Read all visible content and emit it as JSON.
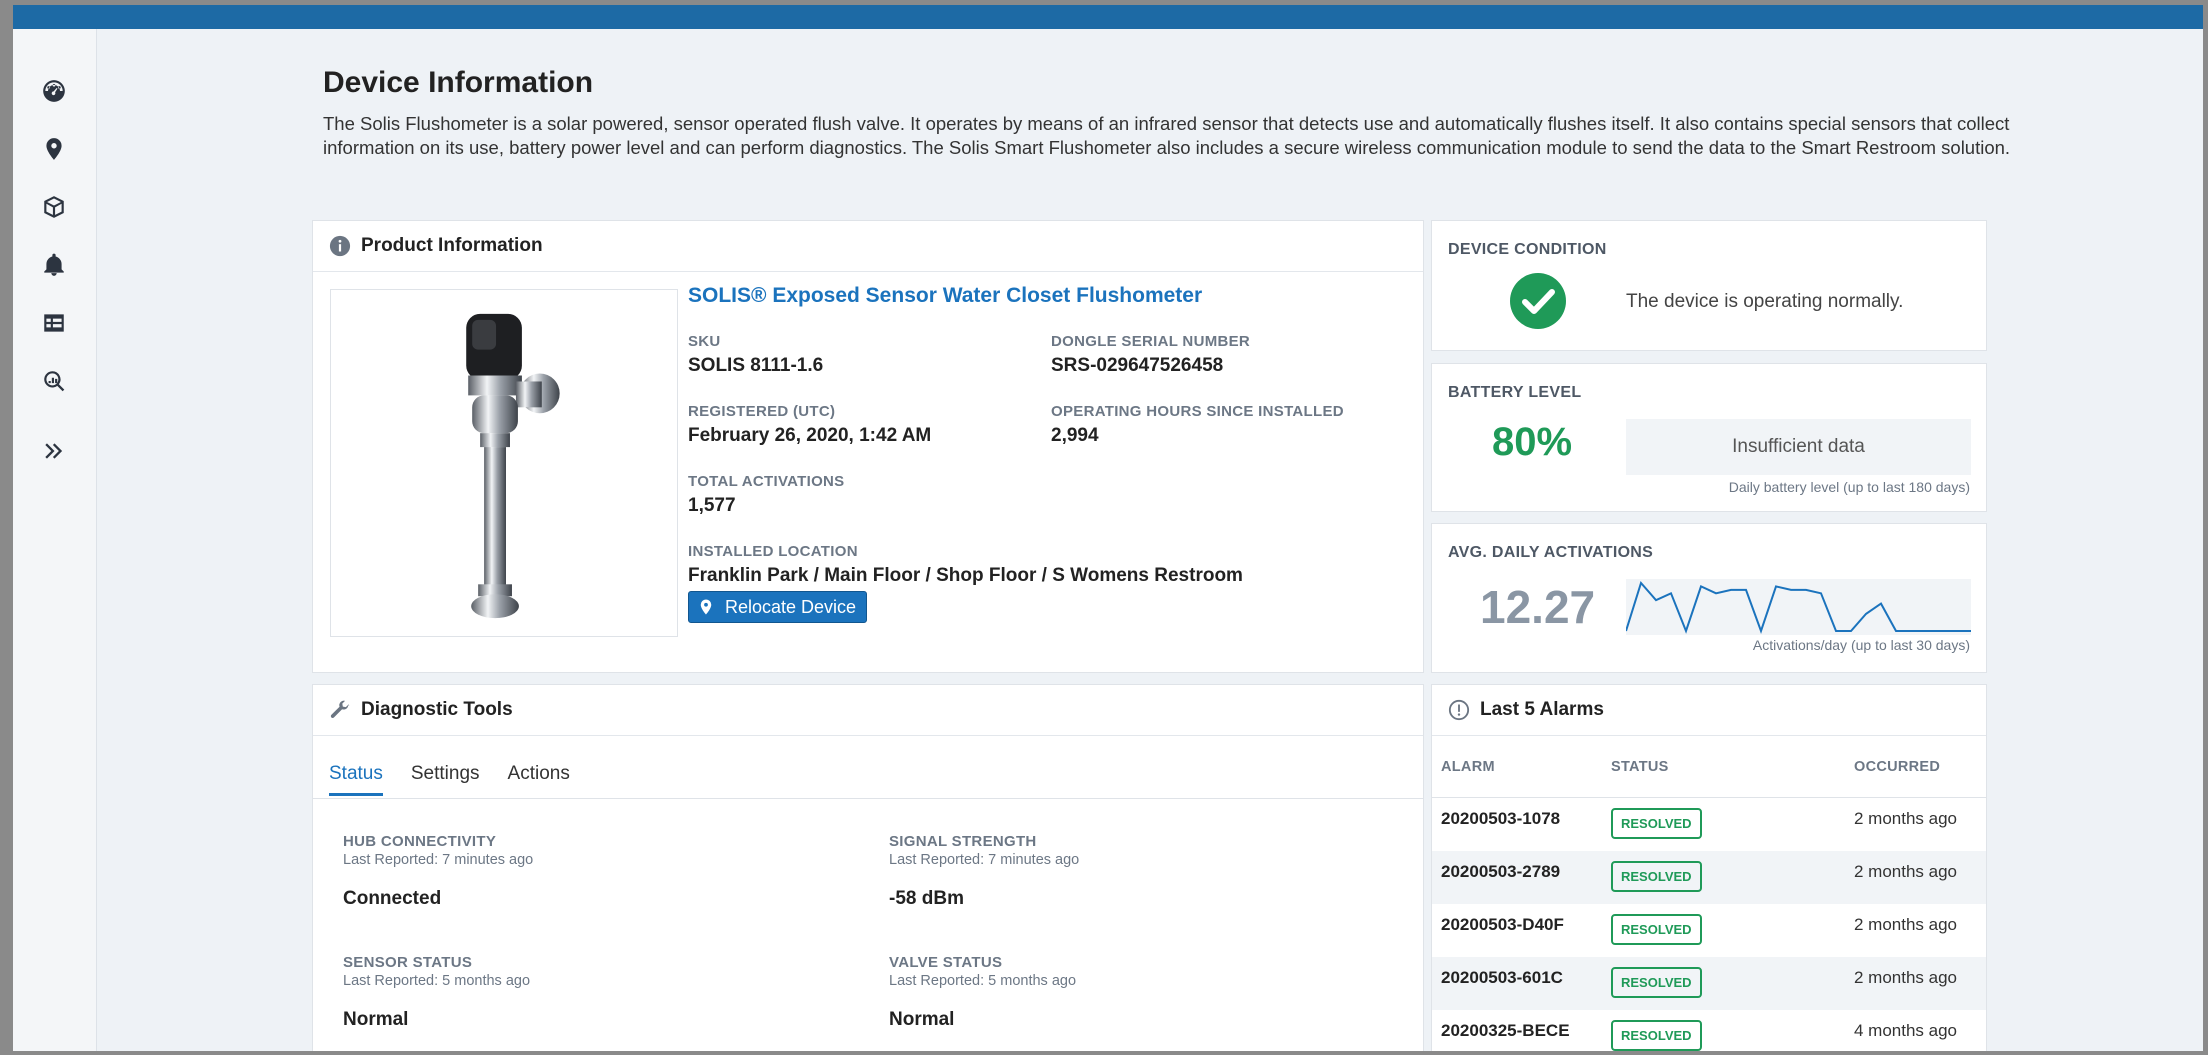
{
  "page": {
    "title": "Device Information",
    "intro": "The Solis Flushometer is a solar powered, sensor operated flush valve. It operates by means of an infrared sensor that detects use and automatically flushes itself. It also contains special sensors that collect information on its use, battery power level and can perform diagnostics. The Solis Smart Flushometer also includes a secure wireless communication module to send the data to the Smart Restroom solution."
  },
  "sidebar": {
    "items": [
      {
        "icon": "dashboard-icon"
      },
      {
        "icon": "location-pin-icon"
      },
      {
        "icon": "cube-icon"
      },
      {
        "icon": "bell-icon"
      },
      {
        "icon": "table-icon"
      },
      {
        "icon": "search-analytics-icon"
      },
      {
        "icon": "chevron-double-right-icon"
      }
    ]
  },
  "product": {
    "header": "Product Information",
    "name": "SOLIS® Exposed Sensor Water Closet Flushometer",
    "sku_label": "SKU",
    "sku": "SOLIS 8111-1.6",
    "dongle_label": "DONGLE SERIAL NUMBER",
    "dongle": "SRS-029647526458",
    "registered_label": "REGISTERED (UTC)",
    "registered": "February 26, 2020, 1:42 AM",
    "hours_label": "OPERATING HOURS SINCE INSTALLED",
    "hours": "2,994",
    "activations_label": "TOTAL ACTIVATIONS",
    "activations": "1,577",
    "location_label": "INSTALLED LOCATION",
    "location": "Franklin Park / Main Floor / Shop Floor / S Womens Restroom",
    "relocate_label": "Relocate Device"
  },
  "condition": {
    "title": "DEVICE CONDITION",
    "message": "The device is operating normally.",
    "status_color": "#1f9a58"
  },
  "battery": {
    "title": "BATTERY LEVEL",
    "value": "80%",
    "chart_text": "Insufficient data",
    "caption": "Daily battery level (up to last 180 days)",
    "accent": "#1f9a58"
  },
  "activations": {
    "title": "AVG. DAILY ACTIVATIONS",
    "value": "12.27",
    "caption": "Activations/day (up to last 30 days)",
    "sparkline": [
      0,
      14,
      9,
      11,
      0,
      13,
      11,
      12,
      12,
      0,
      13,
      12,
      12,
      11,
      0,
      0,
      5,
      8,
      0,
      0,
      0,
      0,
      0,
      0
    ],
    "line_color": "#1b73bd"
  },
  "diagnostics": {
    "header": "Diagnostic Tools",
    "tabs": [
      "Status",
      "Settings",
      "Actions"
    ],
    "items": [
      {
        "label": "HUB CONNECTIVITY",
        "reported": "Last Reported: 7 minutes ago",
        "value": "Connected"
      },
      {
        "label": "SIGNAL STRENGTH",
        "reported": "Last Reported: 7 minutes ago",
        "value": "-58 dBm"
      },
      {
        "label": "SENSOR STATUS",
        "reported": "Last Reported: 5 months ago",
        "value": "Normal"
      },
      {
        "label": "VALVE STATUS",
        "reported": "Last Reported: 5 months ago",
        "value": "Normal"
      }
    ]
  },
  "alarms": {
    "header": "Last 5 Alarms",
    "columns": [
      "ALARM",
      "STATUS",
      "OCCURRED"
    ],
    "rows": [
      {
        "id": "20200503-1078",
        "status": "RESOLVED",
        "occurred": "2 months ago"
      },
      {
        "id": "20200503-2789",
        "status": "RESOLVED",
        "occurred": "2 months ago"
      },
      {
        "id": "20200503-D40F",
        "status": "RESOLVED",
        "occurred": "2 months ago"
      },
      {
        "id": "20200503-601C",
        "status": "RESOLVED",
        "occurred": "2 months ago"
      },
      {
        "id": "20200325-BECE",
        "status": "RESOLVED",
        "occurred": "4 months ago"
      }
    ]
  }
}
